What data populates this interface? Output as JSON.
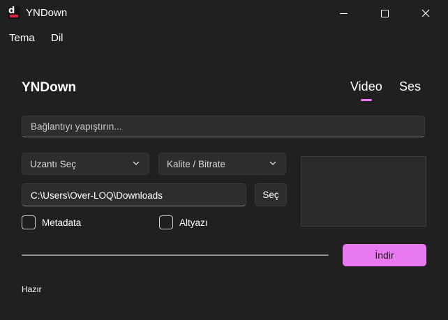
{
  "window": {
    "title": "YNDown",
    "icon": "app-logo-icon",
    "controls": [
      "minimize-icon",
      "maximize-icon",
      "close-icon"
    ]
  },
  "menu": {
    "items": [
      {
        "label": "Tema"
      },
      {
        "label": "Dil"
      }
    ]
  },
  "main": {
    "heading": "YNDown",
    "tabs": [
      {
        "label": "Video",
        "active": true
      },
      {
        "label": "Ses",
        "active": false
      }
    ],
    "link_input": {
      "value": "",
      "placeholder": "Bağlantıyı yapıştırın..."
    },
    "extension_select": {
      "value": "Uzantı Seç"
    },
    "quality_select": {
      "value": "Kalite / Bitrate"
    },
    "path": {
      "value": "C:\\Users\\Over-LOQ\\Downloads"
    },
    "browse_button": "Seç",
    "checkboxes": [
      {
        "label": "Metadata",
        "checked": false
      },
      {
        "label": "Altyazı",
        "checked": false
      }
    ],
    "progress": 0,
    "download_button": "İndir"
  },
  "status": "Hazır",
  "colors": {
    "accent": "#e879f0",
    "background": "#202020",
    "control_bg": "#2d2d2d",
    "brand_red": "#d9233a"
  }
}
